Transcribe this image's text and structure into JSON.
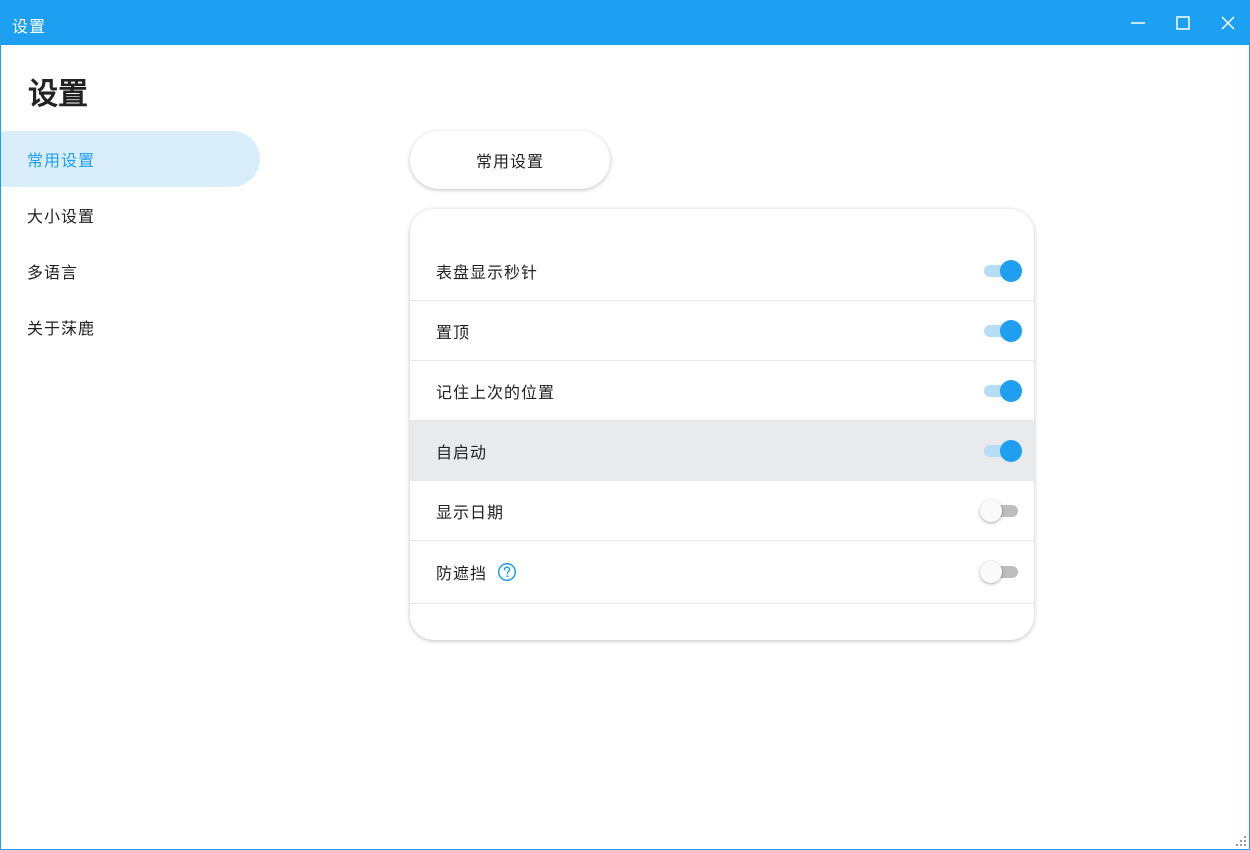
{
  "window": {
    "title": "设置",
    "controls": [
      "minimize-icon",
      "maximize-icon",
      "close-icon"
    ],
    "accent": "#1ea0f2"
  },
  "page": {
    "title": "设置"
  },
  "sidebar": {
    "items": [
      {
        "label": "常用设置",
        "active": true
      },
      {
        "label": "大小设置",
        "active": false
      },
      {
        "label": "多语言",
        "active": false
      },
      {
        "label": "关于莯鹿",
        "active": false
      }
    ]
  },
  "section": {
    "tab_label": "常用设置"
  },
  "settings": [
    {
      "label": "表盘显示秒针",
      "enabled": true
    },
    {
      "label": "置顶",
      "enabled": true
    },
    {
      "label": "记住上次的位置",
      "enabled": true
    },
    {
      "label": "自启动",
      "enabled": true
    },
    {
      "label": "显示日期",
      "enabled": false
    },
    {
      "label": "防遮挡",
      "enabled": false,
      "icon": "help-icon"
    }
  ],
  "colors": {
    "toggle_on": "#1e9ff0",
    "toggle_on_track": "#b7dcf6",
    "toggle_off_track": "#bdbdbd",
    "sidebar_active_bg": "#daedfb",
    "row_hover_bg": "#e9eaeb"
  }
}
